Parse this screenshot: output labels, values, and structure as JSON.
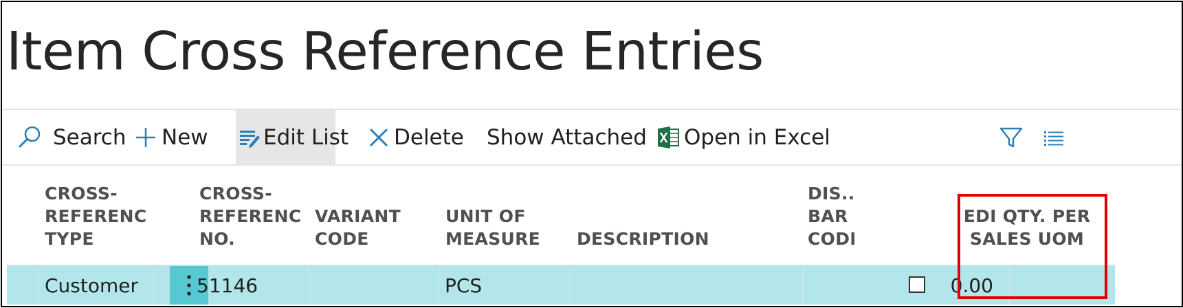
{
  "page": {
    "title": "Item Cross Reference Entries"
  },
  "toolbar": {
    "search_label": "Search",
    "new_label": "New",
    "edit_list_label": "Edit List",
    "delete_label": "Delete",
    "show_attached_label": "Show Attached",
    "open_in_excel_label": "Open in Excel",
    "icons": [
      "search-icon",
      "plus-icon",
      "edit-list-icon",
      "close-icon",
      "excel-icon",
      "filter-icon",
      "list-view-icon"
    ],
    "accent_color": "#2a7fb5"
  },
  "table": {
    "columns": [
      "CROSS-\nREFERENC\nTYPE",
      "CROSS-\nREFERENC\nNO.",
      "VARIANT\nCODE",
      "UNIT OF\nMEASURE",
      "DESCRIPTION",
      "DIS...\nBAR\nCODE",
      "EDI QTY. PER\nSALES UOM"
    ],
    "rows": [
      {
        "cross_reference_type": "Customer",
        "cross_reference_no": "51146",
        "variant_code": "",
        "unit_of_measure": "PCS",
        "description": "",
        "discontinue_bar_code": false,
        "edi_qty_per_sales_uom": "0.00"
      }
    ],
    "selected_row_color": "#b2e6ea",
    "highlight_color": "#e00000"
  }
}
